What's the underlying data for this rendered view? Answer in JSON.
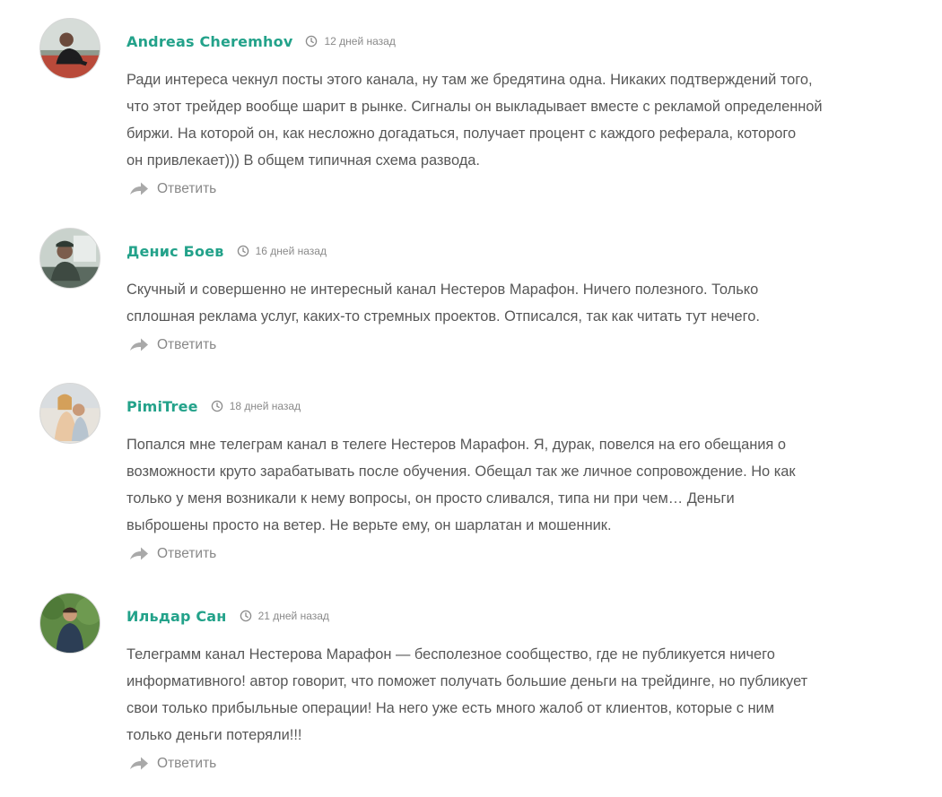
{
  "reply_label": "Ответить",
  "colors": {
    "author": "#23a28a",
    "text": "#575757",
    "meta": "#8a8a8a"
  },
  "comments": [
    {
      "author": "Andreas Cheremhov",
      "date": "12 дней назад",
      "text": "Ради интереса чекнул посты этого канала, ну там же бредятина одна. Никаких подтверждений того,\nчто этот трейдер вообще шарит в рынке. Сигналы он выкладывает вместе с рекламой определенной\nбиржи. На которой он, как несложно догадаться, получает процент с каждого реферала, которого\nон привлекает))) В общем типичная схема развода."
    },
    {
      "author": "Денис Боев",
      "date": "16 дней назад",
      "text": "Скучный и совершенно не интересный канал Нестеров Марафон. Ничего полезного. Только\nсплошная реклама услуг, каких-то стремных проектов. Отписался, так как читать тут нечего."
    },
    {
      "author": "PimiTree",
      "date": "18 дней назад",
      "text": "Попался мне телеграм канал в телеге Нестеров Марафон. Я, дурак, повелся на его обещания о\nвозможности круто зарабатывать после обучения. Обещал так же личное сопровождение. Но как\nтолько у меня возникали к нему вопросы, он просто сливался, типа ни при чем… Деньги\nвыброшены просто на ветер. Не верьте ему, он шарлатан и мошенник."
    },
    {
      "author": "Ильдар Сан",
      "date": "21 дней назад",
      "text": "Телеграмм канал Нестерова Марафон — бесполезное сообщество, где не публикуется ничего\nинформативного! автор говорит, что поможет получать большие деньги на трейдинге, но публикует\nсвои только прибыльные операции! На него уже есть много жалоб от клиентов, которые с ним\nтолько деньги потеряли!!!"
    }
  ]
}
